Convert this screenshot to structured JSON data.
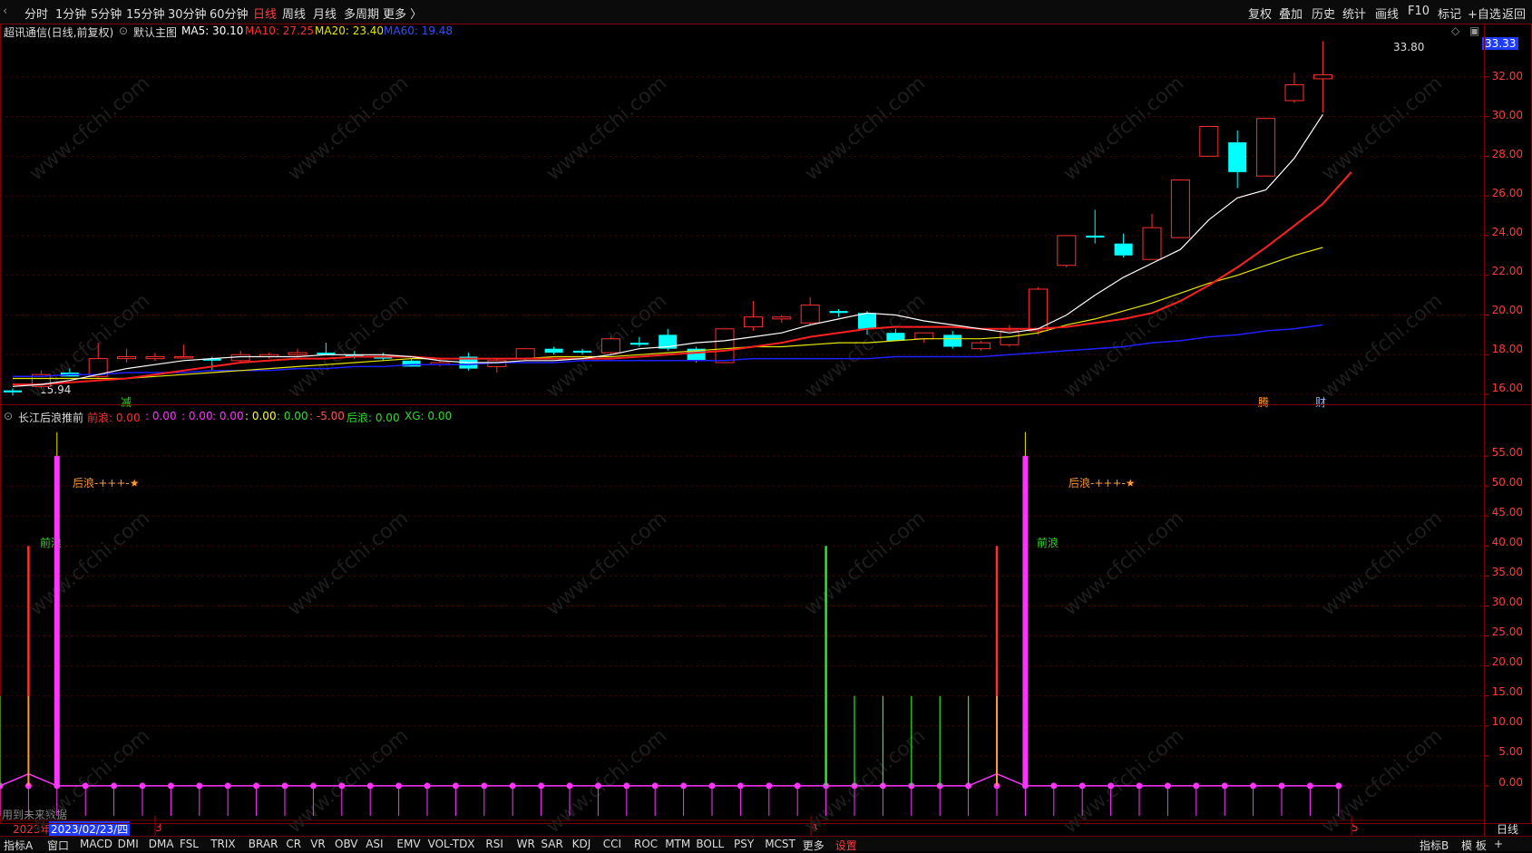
{
  "toolbar": {
    "left_items": [
      "分时",
      "1分钟",
      "5分钟",
      "15分钟",
      "30分钟",
      "60分钟",
      "日线",
      "周线",
      "月线",
      "多周期",
      "更多 〉"
    ],
    "active": "日线",
    "right_items": [
      "复权",
      "叠加",
      "历史",
      "统计",
      "画线",
      "F10",
      "标记",
      "+自选",
      "返回"
    ]
  },
  "main_header": {
    "title": "超讯通信(日线,前复权)",
    "template": "默认主图",
    "ma5": "MA5: 30.10",
    "ma10": "MA10: 27.25",
    "ma20": "MA20: 23.40",
    "ma60": "MA60: 19.48"
  },
  "price_axis": {
    "current": "33.33",
    "ticks": [
      "32.00",
      "30.00",
      "28.00",
      "26.00",
      "24.00",
      "22.00",
      "20.00",
      "18.00",
      "16.00"
    ]
  },
  "main_annotations": {
    "high": "33.80",
    "low": "15.94",
    "mark_a": "减",
    "mark_b": "腾",
    "mark_c": "财"
  },
  "indicator_header": {
    "name": "长江后浪推前",
    "qianlang": "前浪: 0.00",
    "v1": ": 0.00",
    "v2": ": 0.00",
    "v3": ": 0.00",
    "v4": ": 0.00",
    "v5": ": 0.00",
    "v6": ": -5.00",
    "houlang": "后浪: 0.00",
    "xg": "XG: 0.00"
  },
  "indicator_axis": {
    "ticks": [
      "55.00",
      "50.00",
      "45.00",
      "40.00",
      "35.00",
      "30.00",
      "25.00",
      "20.00",
      "15.00",
      "10.00",
      "5.00",
      "0.00"
    ]
  },
  "indicator_annotations": {
    "houlang_text": "后浪-+++-★",
    "qianlang_text": "前浪",
    "future_note": "用到未来数据"
  },
  "date_axis": {
    "year": "2023年",
    "cursor_date": "2023/02/23/四",
    "m3": "3",
    "m4": "4",
    "m5": "5",
    "period": "日线"
  },
  "bottombar": {
    "items": [
      "指标A",
      "窗口",
      "MACD",
      "DMI",
      "DMA",
      "FSL",
      "TRIX",
      "BRAR",
      "CR",
      "VR",
      "OBV",
      "ASI",
      "EMV",
      "VOL-TDX",
      "RSI",
      "WR",
      "SAR",
      "KDJ",
      "CCI",
      "ROC",
      "MTM",
      "BOLL",
      "PSY",
      "MCST",
      "更多",
      "设置"
    ],
    "active": "设置",
    "right_items": [
      "指标B",
      "模 板",
      "+"
    ]
  },
  "watermark": "www.cfchi.com",
  "colors": {
    "up": "#ff3030",
    "down": "#00ffff",
    "ma5": "#ffffff",
    "ma10": "#ff2020",
    "ma20": "#e6e600",
    "ma60": "#2020ff",
    "indicator_magenta": "#ff33ff",
    "indicator_green": "#22ee22"
  },
  "chart_data": {
    "type": "candlestick",
    "candles": [
      {
        "o": 16.2,
        "h": 16.3,
        "l": 15.94,
        "c": 16.1
      },
      {
        "o": 16.4,
        "h": 17.2,
        "l": 16.3,
        "c": 17.0
      },
      {
        "o": 17.1,
        "h": 17.3,
        "l": 16.9,
        "c": 16.9
      },
      {
        "o": 16.9,
        "h": 18.6,
        "l": 16.8,
        "c": 17.8
      },
      {
        "o": 17.8,
        "h": 18.3,
        "l": 17.6,
        "c": 17.9
      },
      {
        "o": 17.8,
        "h": 18.1,
        "l": 17.7,
        "c": 17.9
      },
      {
        "o": 17.9,
        "h": 18.5,
        "l": 17.8,
        "c": 17.9
      },
      {
        "o": 17.8,
        "h": 17.9,
        "l": 17.2,
        "c": 17.7
      },
      {
        "o": 17.7,
        "h": 18.2,
        "l": 17.6,
        "c": 18.0
      },
      {
        "o": 17.9,
        "h": 18.1,
        "l": 17.8,
        "c": 18.0
      },
      {
        "o": 18.0,
        "h": 18.3,
        "l": 17.9,
        "c": 18.1
      },
      {
        "o": 18.1,
        "h": 18.6,
        "l": 18.0,
        "c": 18.0
      },
      {
        "o": 18.0,
        "h": 18.2,
        "l": 17.8,
        "c": 17.9
      },
      {
        "o": 17.9,
        "h": 18.1,
        "l": 17.7,
        "c": 17.8
      },
      {
        "o": 17.7,
        "h": 17.8,
        "l": 17.4,
        "c": 17.4
      },
      {
        "o": 17.5,
        "h": 17.8,
        "l": 17.4,
        "c": 17.6
      },
      {
        "o": 17.9,
        "h": 18.1,
        "l": 17.2,
        "c": 17.3
      },
      {
        "o": 17.4,
        "h": 17.8,
        "l": 17.1,
        "c": 17.7
      },
      {
        "o": 17.8,
        "h": 18.3,
        "l": 17.7,
        "c": 18.3
      },
      {
        "o": 18.3,
        "h": 18.4,
        "l": 18.0,
        "c": 18.1
      },
      {
        "o": 18.2,
        "h": 18.3,
        "l": 18.0,
        "c": 18.1
      },
      {
        "o": 18.1,
        "h": 18.9,
        "l": 18.0,
        "c": 18.8
      },
      {
        "o": 18.6,
        "h": 18.9,
        "l": 18.4,
        "c": 18.5
      },
      {
        "o": 19.0,
        "h": 19.3,
        "l": 18.2,
        "c": 18.3
      },
      {
        "o": 18.3,
        "h": 18.4,
        "l": 17.6,
        "c": 17.7
      },
      {
        "o": 17.6,
        "h": 19.3,
        "l": 17.6,
        "c": 19.3
      },
      {
        "o": 19.4,
        "h": 20.7,
        "l": 19.2,
        "c": 19.9
      },
      {
        "o": 19.8,
        "h": 20.0,
        "l": 19.6,
        "c": 19.9
      },
      {
        "o": 19.6,
        "h": 20.9,
        "l": 19.5,
        "c": 20.5
      },
      {
        "o": 20.2,
        "h": 20.3,
        "l": 19.9,
        "c": 20.1
      },
      {
        "o": 20.1,
        "h": 20.2,
        "l": 19.0,
        "c": 19.3
      },
      {
        "o": 19.1,
        "h": 19.3,
        "l": 18.7,
        "c": 18.7
      },
      {
        "o": 18.8,
        "h": 19.1,
        "l": 18.6,
        "c": 19.1
      },
      {
        "o": 19.0,
        "h": 19.2,
        "l": 18.3,
        "c": 18.4
      },
      {
        "o": 18.3,
        "h": 18.7,
        "l": 18.2,
        "c": 18.6
      },
      {
        "o": 18.5,
        "h": 19.5,
        "l": 18.4,
        "c": 19.2
      },
      {
        "o": 19.2,
        "h": 21.4,
        "l": 19.0,
        "c": 21.3
      },
      {
        "o": 22.5,
        "h": 24.0,
        "l": 22.4,
        "c": 24.0
      },
      {
        "o": 24.0,
        "h": 25.3,
        "l": 23.6,
        "c": 23.9
      },
      {
        "o": 23.6,
        "h": 24.1,
        "l": 22.9,
        "c": 23.0
      },
      {
        "o": 22.8,
        "h": 25.1,
        "l": 22.8,
        "c": 24.4
      },
      {
        "o": 23.9,
        "h": 26.8,
        "l": 23.9,
        "c": 26.8
      },
      {
        "o": 28.0,
        "h": 29.5,
        "l": 28.0,
        "c": 29.5
      },
      {
        "o": 28.7,
        "h": 29.3,
        "l": 26.4,
        "c": 27.2
      },
      {
        "o": 27.0,
        "h": 29.9,
        "l": 27.0,
        "c": 29.9
      },
      {
        "o": 30.8,
        "h": 32.2,
        "l": 30.7,
        "c": 31.6
      },
      {
        "o": 31.9,
        "h": 33.8,
        "l": 30.2,
        "c": 32.1
      }
    ],
    "ma5": [
      16.4,
      16.5,
      16.7,
      17.0,
      17.3,
      17.5,
      17.7,
      17.8,
      17.9,
      17.9,
      17.9,
      18.0,
      18.0,
      18.0,
      17.9,
      17.7,
      17.6,
      17.6,
      17.7,
      17.7,
      17.8,
      18.0,
      18.3,
      18.4,
      18.6,
      18.7,
      18.9,
      19.1,
      19.5,
      19.8,
      20.1,
      20.0,
      19.7,
      19.5,
      19.3,
      19.1,
      19.3,
      20.0,
      21.0,
      21.9,
      22.6,
      23.3,
      24.8,
      25.9,
      26.3,
      27.9,
      30.1
    ],
    "ma10": [
      16.5,
      16.5,
      16.6,
      16.7,
      16.8,
      17.0,
      17.2,
      17.4,
      17.6,
      17.7,
      17.8,
      17.8,
      17.9,
      17.9,
      17.9,
      17.8,
      17.8,
      17.8,
      17.8,
      17.8,
      17.8,
      17.8,
      17.9,
      18.0,
      18.1,
      18.2,
      18.4,
      18.6,
      18.9,
      19.1,
      19.3,
      19.4,
      19.4,
      19.4,
      19.3,
      19.3,
      19.3,
      19.4,
      19.6,
      19.8,
      20.1,
      20.7,
      21.5,
      22.4,
      23.4,
      24.5,
      25.6,
      27.2
    ],
    "ma20": [
      16.8,
      16.8,
      16.8,
      16.8,
      16.8,
      16.9,
      17.0,
      17.1,
      17.2,
      17.3,
      17.4,
      17.5,
      17.6,
      17.7,
      17.8,
      17.8,
      17.8,
      17.8,
      17.8,
      17.9,
      17.9,
      17.9,
      18.0,
      18.1,
      18.2,
      18.3,
      18.4,
      18.4,
      18.5,
      18.6,
      18.6,
      18.7,
      18.8,
      18.8,
      18.8,
      18.9,
      19.1,
      19.5,
      19.8,
      20.2,
      20.6,
      21.1,
      21.6,
      22.0,
      22.5,
      23.0,
      23.4
    ],
    "ma60": [
      16.9,
      16.9,
      17.0,
      17.0,
      17.1,
      17.1,
      17.1,
      17.2,
      17.2,
      17.2,
      17.3,
      17.3,
      17.4,
      17.4,
      17.5,
      17.5,
      17.5,
      17.6,
      17.6,
      17.6,
      17.7,
      17.7,
      17.7,
      17.7,
      17.7,
      17.7,
      17.8,
      17.8,
      17.8,
      17.8,
      17.8,
      17.9,
      17.9,
      17.9,
      17.9,
      18.0,
      18.1,
      18.2,
      18.3,
      18.4,
      18.6,
      18.7,
      18.9,
      19.0,
      19.2,
      19.3,
      19.5
    ],
    "indicator": {
      "magenta_bars": {
        "1": 55,
        "35": 55
      },
      "red_bars": {
        "0": 40,
        "34": 40
      },
      "green_bars": {
        "28": 40,
        "29": 15,
        "30": 15,
        "31": 15,
        "32": 15,
        "33": 15
      },
      "thin_green": {
        "-1": 15
      }
    },
    "y_range": [
      15.5,
      34.5
    ],
    "indicator_range": [
      -5,
      60
    ]
  }
}
